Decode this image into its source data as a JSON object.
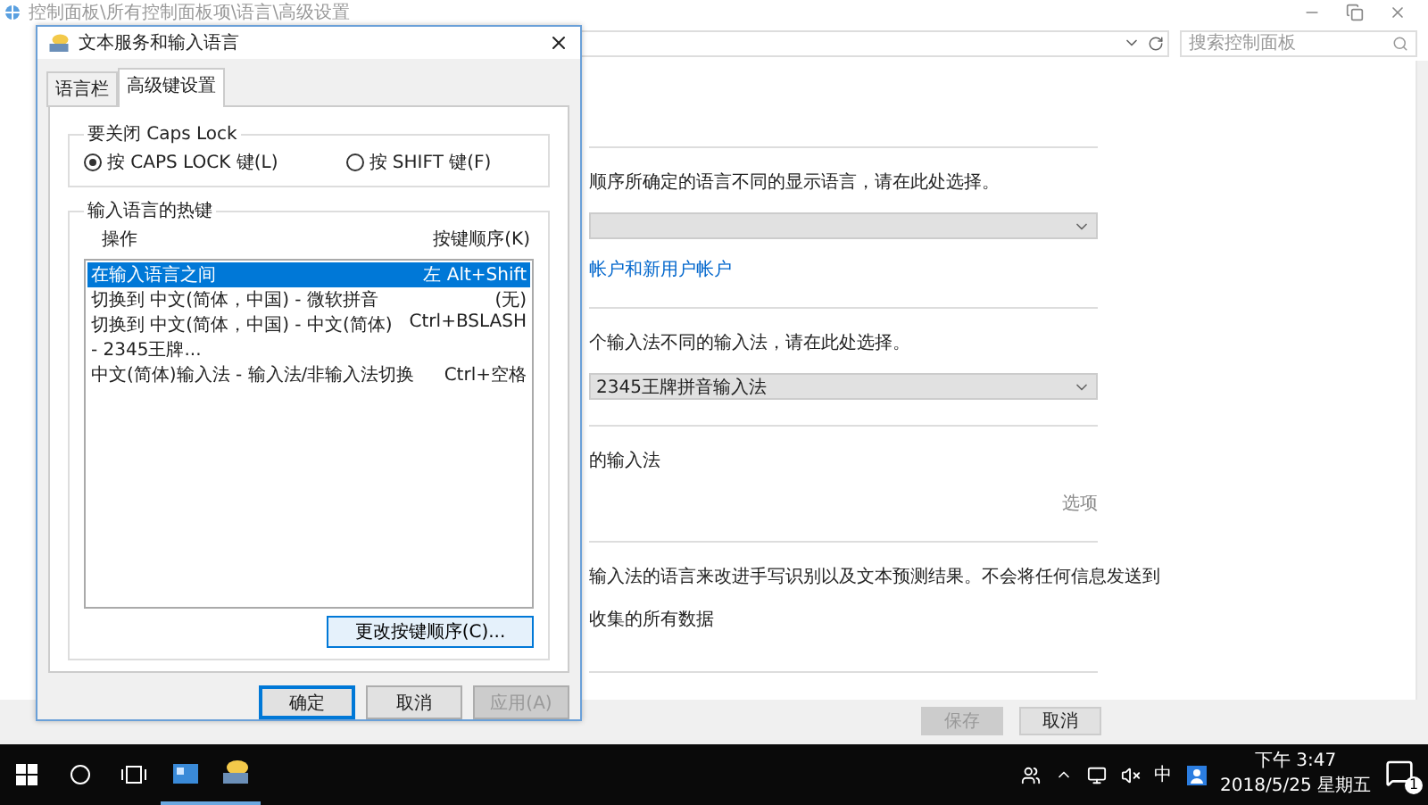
{
  "window": {
    "title": "控制面板\\所有控制面板项\\语言\\高级设置",
    "search": {
      "placeholder": "搜索控制面板"
    }
  },
  "sections": [
    {
      "items": [
        {
          "kind": "text",
          "text": "顺序所确定的语言不同的显示语言，请在此处选择。"
        },
        {
          "kind": "dropdown"
        },
        {
          "kind": "link",
          "text": "帐户和新用户帐户"
        }
      ]
    },
    {
      "items": [
        {
          "kind": "text",
          "text": "个输入法不同的输入法，请在此处选择。"
        },
        {
          "kind": "dropdown",
          "value": "2345王牌拼音输入法"
        }
      ]
    },
    {
      "items": [
        {
          "kind": "text",
          "text": "的输入法"
        },
        {
          "kind": "option",
          "text": "选项"
        }
      ]
    },
    {
      "items": [
        {
          "kind": "text",
          "text": "输入法的语言来改进手写识别以及文本预测结果。不会将任何信息发送到"
        },
        {
          "kind": "text",
          "text": "收集的所有数据"
        }
      ]
    }
  ],
  "footer_buttons": [
    {
      "label": "保存",
      "disabled": true
    },
    {
      "label": "取消",
      "disabled": false
    }
  ],
  "dialog": {
    "title": "文本服务和输入语言",
    "tabs": [
      {
        "label": "语言栏",
        "selected": false
      },
      {
        "label": "高级键设置",
        "selected": true
      }
    ],
    "caps_group": {
      "title": "要关闭 Caps Lock",
      "options": [
        {
          "label": "按 CAPS LOCK 键(L)",
          "selected": true
        },
        {
          "label": "按 SHIFT 键(F)",
          "selected": false
        }
      ]
    },
    "hotkeys": {
      "title": "输入语言的热键",
      "columns": [
        "操作",
        "按键顺序(K)"
      ],
      "rows": [
        {
          "action": "在输入语言之间",
          "keys": "左 Alt+Shift",
          "selected": true
        },
        {
          "action": "切换到 中文(简体，中国) - 微软拼音",
          "keys": "(无)",
          "selected": false
        },
        {
          "action": "切换到 中文(简体，中国) - 中文(简体) - 2345王牌...",
          "keys": "Ctrl+BSLASH",
          "selected": false
        },
        {
          "action": "中文(简体)输入法 - 输入法/非输入法切换",
          "keys": "Ctrl+空格",
          "selected": false
        }
      ],
      "change_button": "更改按键顺序(C)..."
    },
    "buttons": [
      {
        "label": "确定",
        "default": true,
        "disabled": false
      },
      {
        "label": "取消",
        "default": false,
        "disabled": false
      },
      {
        "label": "应用(A)",
        "default": false,
        "disabled": true
      }
    ]
  },
  "tray": {
    "ime": "中",
    "time": "下午 3:47",
    "date": "2018/5/25 星期五",
    "notifications": "1"
  }
}
